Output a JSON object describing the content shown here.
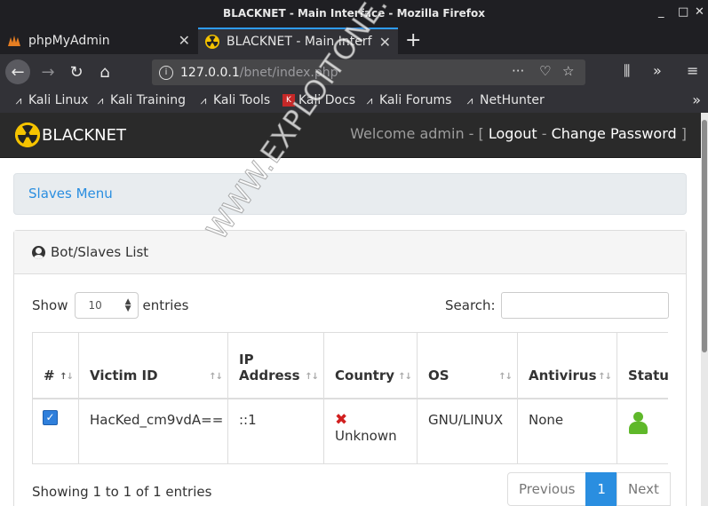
{
  "window": {
    "title": "BLACKNET - Main Interface - Mozilla Firefox",
    "minimize_glyph": "_",
    "maximize_glyph": "□",
    "close_glyph": "✕"
  },
  "tabs": [
    {
      "label": "phpMyAdmin",
      "icon": "phpmyadmin-icon",
      "active": false
    },
    {
      "label": "BLACKNET - Main Interf",
      "icon": "radiation-icon",
      "active": true
    }
  ],
  "urlbar": {
    "host": "127.0.0.1",
    "path": "/bnet/index.php"
  },
  "bookmarks": [
    {
      "label": "Kali Linux",
      "icon": "kali-icon"
    },
    {
      "label": "Kali Training",
      "icon": "kali-icon"
    },
    {
      "label": "Kali Tools",
      "icon": "kali-icon"
    },
    {
      "label": "Kali Docs",
      "icon": "kali-docs-icon"
    },
    {
      "label": "Kali Forums",
      "icon": "kali-icon"
    },
    {
      "label": "NetHunter",
      "icon": "nethunter-icon"
    }
  ],
  "app": {
    "brand": "BLACKNET",
    "welcome_prefix": "Welcome admin - [ ",
    "logout": "Logout",
    "separator": " - ",
    "change_password": "Change Password",
    "welcome_suffix": " ]"
  },
  "menu": {
    "slaves_menu": "Slaves Menu"
  },
  "panel": {
    "heading": "Bot/Slaves List"
  },
  "datatable": {
    "show_label": "Show",
    "page_size": "10",
    "entries_label": "entries",
    "search_label": "Search:",
    "columns": [
      "#",
      "Victim ID",
      "IP Address",
      "Country",
      "OS",
      "Antivirus",
      "Status"
    ],
    "rows": [
      {
        "victim_id": "HacKed_cm9vdA==",
        "ip": "::1",
        "country": "Unknown",
        "os": "GNU/LINUX",
        "antivirus": "None",
        "status": "online"
      }
    ],
    "info": "Showing 1 to 1 of 1 entries",
    "pagination": {
      "previous": "Previous",
      "current": "1",
      "next": "Next"
    }
  },
  "watermark": "WWW.EXPLOITONE.COM",
  "colors": {
    "accent": "#2a8ee0",
    "appbar": "#2a2a2a",
    "online": "#5fb82a",
    "error": "#d11f1f"
  }
}
